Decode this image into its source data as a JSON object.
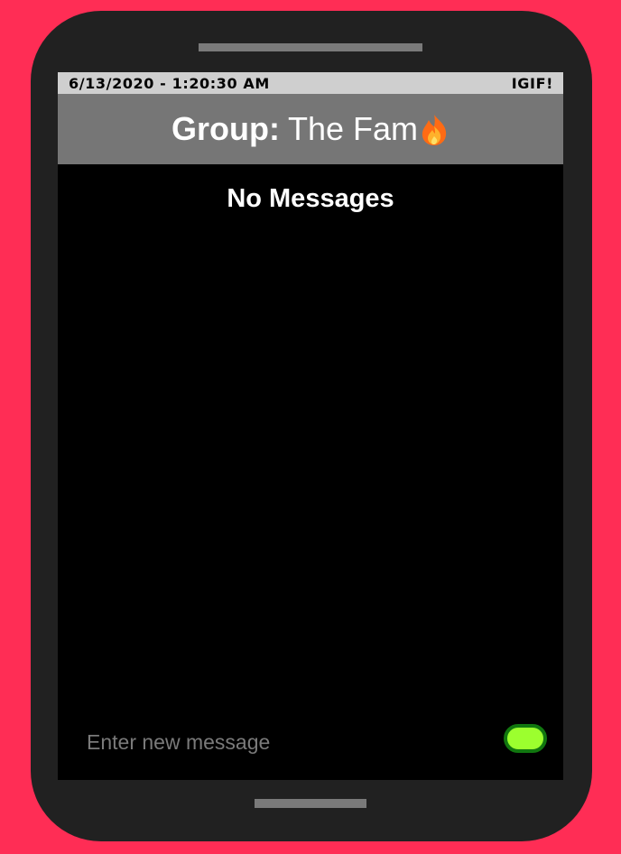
{
  "status_bar": {
    "datetime": "6/13/2020 - 1:20:30 AM",
    "carrier": "IGIF!"
  },
  "header": {
    "label": "Group:",
    "group_name": "The Fam",
    "icon": "flame-icon"
  },
  "messages": {
    "empty_text": "No Messages"
  },
  "composer": {
    "placeholder": "Enter new message",
    "value": ""
  },
  "colors": {
    "background": "#ff2d55",
    "phone_body": "#212121",
    "status_bar": "#cfcfcf",
    "header": "#767676",
    "screen": "#000000",
    "send_button_fill": "#9cff2e",
    "send_button_border": "#11770f"
  }
}
